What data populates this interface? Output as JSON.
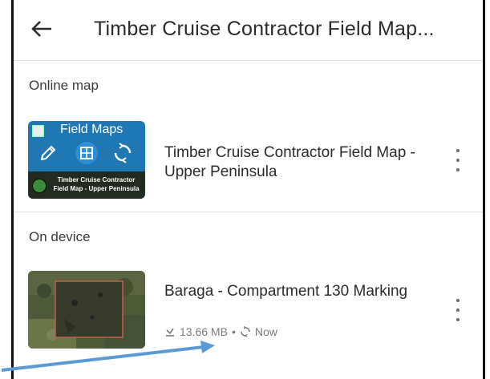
{
  "app_bar": {
    "title": "Timber Cruise Contractor Field Map..."
  },
  "sections": {
    "online": {
      "label": "Online map",
      "item": {
        "thumbnail": {
          "brand": "Field Maps",
          "caption": "Timber Cruise Contractor Field Map - Upper Peninsula"
        },
        "title": "Timber Cruise Contractor Field Map - Upper Peninsula"
      }
    },
    "device": {
      "label": "On device",
      "item": {
        "title": "Baraga - Compartment 130 Marking",
        "size": "13.66 MB",
        "separator": "•",
        "sync_status": "Now"
      }
    }
  },
  "icons": {
    "back": "arrow-left-icon",
    "more": "more-vertical-icon",
    "download": "download-icon",
    "sync": "sync-icon"
  },
  "colors": {
    "field_maps_blue": "#1f78b4",
    "annotation_arrow": "#5b9bd5",
    "text_primary": "#2b2b2b",
    "text_secondary": "#7a7a7a"
  }
}
